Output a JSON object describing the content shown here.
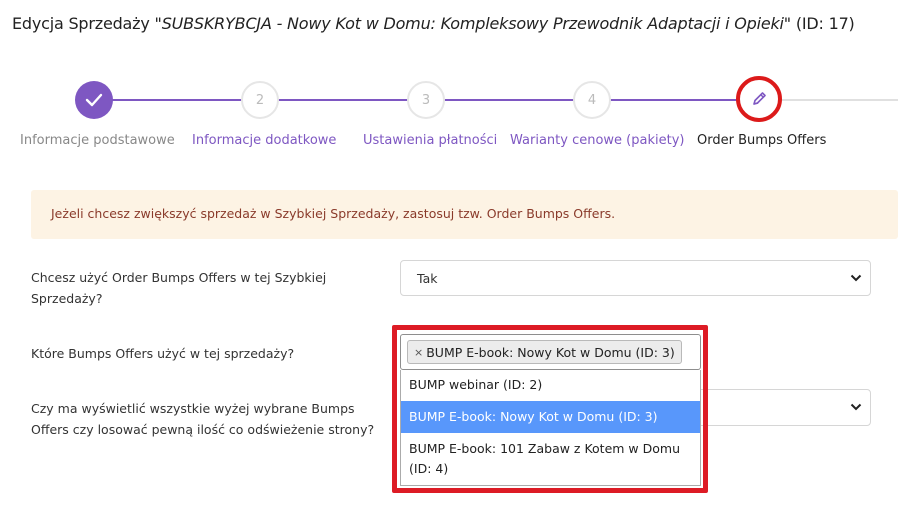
{
  "page": {
    "title_prefix": "Edycja Sprzedaży \"",
    "title_name": "SUBSKRYBCJA - Nowy Kot w Domu: Kompleksowy Przewodnik Adaptacji i Opieki",
    "title_suffix": "\" (ID: 17)"
  },
  "stepper": {
    "steps": [
      {
        "number": "",
        "label": "Informacje podstawowe",
        "state": "done",
        "icon": "check-icon"
      },
      {
        "number": "2",
        "label": "Informacje dodatkowe",
        "state": "todo"
      },
      {
        "number": "3",
        "label": "Ustawienia płatności",
        "state": "todo"
      },
      {
        "number": "4",
        "label": "Warianty cenowe (pakiety)",
        "state": "todo"
      },
      {
        "number": "",
        "label": "Order Bumps Offers",
        "state": "active",
        "icon": "pencil-icon"
      }
    ]
  },
  "alert": {
    "text": "Jeżeli chcesz zwiększyć sprzedaż w Szybkiej Sprzedaży, zastosuj tzw. Order Bumps Offers."
  },
  "form": {
    "use_bumps": {
      "label_line1": "Chcesz użyć Order Bumps Offers w tej Szybkiej",
      "label_line2": "Sprzedaży?",
      "value": "Tak"
    },
    "which_bumps": {
      "label": "Które Bumps Offers użyć w tej sprzedaży?",
      "selected_tag": "BUMP E-book: Nowy Kot w Domu (ID: 3)",
      "remove_symbol": "×",
      "options": [
        {
          "text": "BUMP webinar (ID: 2)",
          "highlighted": false
        },
        {
          "text": "BUMP E-book: Nowy Kot w Domu (ID: 3)",
          "highlighted": true
        },
        {
          "text_line1": "BUMP E-book: 101 Zabaw z Kotem w Domu",
          "text_line2": "(ID: 4)",
          "highlighted": false
        }
      ]
    },
    "display_mode": {
      "label_line1": "Czy ma wyświetlić wszystkie wyżej wybrane Bumps",
      "label_line2": "Offers czy losować pewną ilość co odświeżenie strony?",
      "value": ""
    }
  },
  "colors": {
    "accent": "#7e57c2",
    "highlight": "#dd1b25",
    "alert_bg": "#fdf3e4",
    "option_highlight": "#5897fb"
  }
}
